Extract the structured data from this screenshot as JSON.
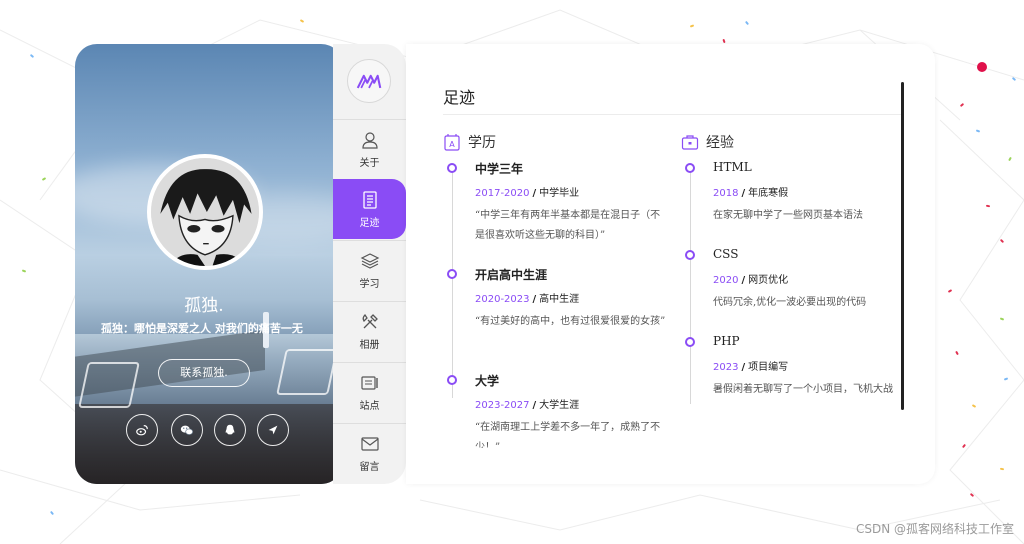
{
  "profile": {
    "name": "孤独.",
    "motto": "孤独：哪怕是深爱之人 对我们的痛苦一无",
    "contact_label": "联系孤独.",
    "social_icons": [
      "weibo-icon",
      "wechat-icon",
      "qq-icon",
      "send-icon"
    ]
  },
  "nav": {
    "items": [
      {
        "label": "关于",
        "icon": "user-icon"
      },
      {
        "label": "足迹",
        "icon": "document-icon"
      },
      {
        "label": "学习",
        "icon": "layers-icon"
      },
      {
        "label": "相册",
        "icon": "tools-icon"
      },
      {
        "label": "站点",
        "icon": "site-icon"
      },
      {
        "label": "留言",
        "icon": "mail-icon"
      }
    ],
    "active_index": 1,
    "accent": "#8a4cf5"
  },
  "main": {
    "title": "足迹",
    "education": {
      "heading": "学历",
      "items": [
        {
          "title": "中学三年",
          "date": "2017-2020",
          "tag": "中学毕业",
          "desc": "“中学三年有两年半基本都是在混日子（不是很喜欢听这些无聊的科目）”"
        },
        {
          "title": "开启高中生涯",
          "date": "2020-2023",
          "tag": "高中生涯",
          "desc": "“有过美好的高中，也有过很爱很爱的女孩”"
        },
        {
          "title": "大学",
          "date": "2023-2027",
          "tag": "大学生涯",
          "desc": "“在湖南理工上学差不多一年了，成熟了不少！”"
        }
      ]
    },
    "experience": {
      "heading": "经验",
      "items": [
        {
          "title": "HTML",
          "date": "2018",
          "tag": "年底寒假",
          "desc": "在家无聊中学了一些网页基本语法"
        },
        {
          "title": "CSS",
          "date": "2020",
          "tag": "网页优化",
          "desc": "代码冗余,优化一波必要出现的代码"
        },
        {
          "title": "PHP",
          "date": "2023",
          "tag": "项目编写",
          "desc": "暑假闲着无聊写了一个小项目，飞机大战"
        }
      ]
    }
  },
  "watermark": "CSDN @孤客网络科技工作室"
}
